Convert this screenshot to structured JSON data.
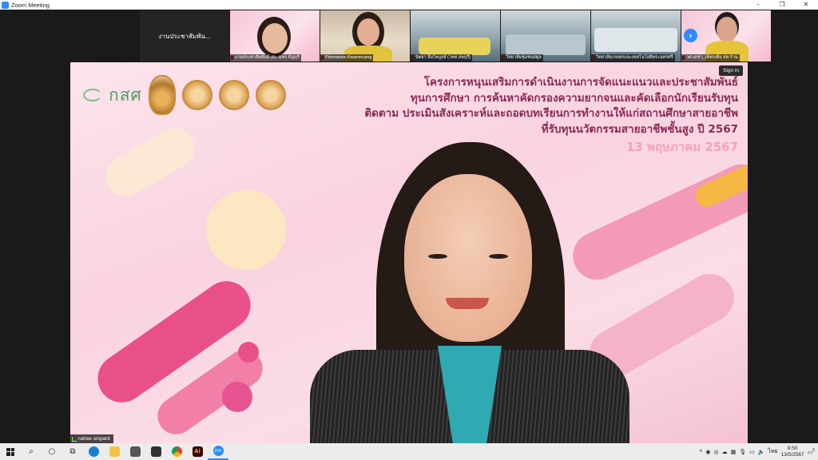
{
  "window": {
    "title": "Zoom Meeting",
    "controls": [
      "–",
      "❐",
      "✕"
    ]
  },
  "thumbnails": [
    {
      "name": "งานประชาสัมพัน...",
      "label": ""
    },
    {
      "name": "",
      "label": "งานประชาสัมพันธ์ สอ. มทร.ธัญบุรี"
    },
    {
      "name": "",
      "label": "Pimmanee Kwanmuang"
    },
    {
      "name": "",
      "label": "นิตยา  ลิ้มไพบูลย์ (วพท.ลพบุรี)"
    },
    {
      "name": "",
      "label": "วิทยาลัยชุมชนสตูล"
    },
    {
      "name": "",
      "label": "วิทยาลัยเกษตรและเทคโนโลยีพระนครศรี"
    },
    {
      "name": "",
      "label": "วศ.เดชา_เพ็ชรเต็ม สค.ร้าน"
    }
  ],
  "speaker": {
    "name": "ratree sinpant",
    "sign_in": "Sign in",
    "slide": {
      "logo_text": "กสศ",
      "lines": [
        "โครงการหนุนเสริมการดำเนินงานการจัดแนะแนวและประชาสัมพันธ์",
        "ทุนการศึกษา การค้นหาคัดกรองความยากจนและคัดเลือกนักเรียนรับทุน",
        "ติดตาม ประเมินสังเคราะห์และถอดบทเรียนการทำงานให้แก่สถานศึกษาสายอาชีพ",
        "ที่รับทุนนวัตกรรมสายอาชีพชั้นสูง ปี 2567"
      ],
      "date": "13  พฤษภาคม 2567"
    }
  },
  "taskbar": {
    "lang": "ไทย",
    "time": "9:50",
    "date": "13/5/2567",
    "notif_count": "5",
    "apps": [
      {
        "name": "edge",
        "color": "#1b7fd0"
      },
      {
        "name": "explorer",
        "color": "#f3c444"
      },
      {
        "name": "mail",
        "color": "#555555"
      },
      {
        "name": "photos",
        "color": "#333333"
      },
      {
        "name": "chrome",
        "color": "#db4437"
      },
      {
        "name": "illustrator",
        "color": "#330000"
      },
      {
        "name": "zoom",
        "color": "#2d8cff"
      }
    ],
    "illustrator_label": "Ai",
    "zoom_label": "zm"
  },
  "colors": {
    "accent": "#2d8cff",
    "slide_text": "#8a2a56",
    "slide_date": "#f7a1b9"
  }
}
